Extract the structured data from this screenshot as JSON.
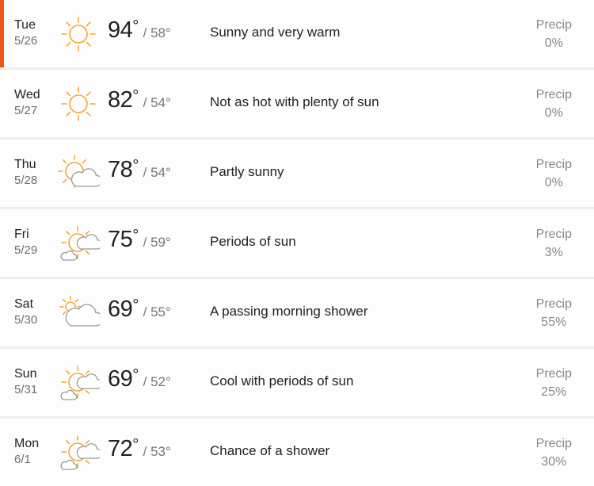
{
  "forecast": [
    {
      "dow": "Tue",
      "date": "5/26",
      "icon": "sunny-icon",
      "hi": "94",
      "lo": "58",
      "phrase": "Sunny and very warm",
      "precip_label": "Precip",
      "precip": "0%",
      "active": true
    },
    {
      "dow": "Wed",
      "date": "5/27",
      "icon": "sunny-icon",
      "hi": "82",
      "lo": "54",
      "phrase": "Not as hot with plenty of sun",
      "precip_label": "Precip",
      "precip": "0%"
    },
    {
      "dow": "Thu",
      "date": "5/28",
      "icon": "partly-sunny-icon",
      "hi": "78",
      "lo": "54",
      "phrase": "Partly sunny",
      "precip_label": "Precip",
      "precip": "0%"
    },
    {
      "dow": "Fri",
      "date": "5/29",
      "icon": "periods-of-sun-icon",
      "hi": "75",
      "lo": "59",
      "phrase": "Periods of sun",
      "precip_label": "Precip",
      "precip": "3%"
    },
    {
      "dow": "Sat",
      "date": "5/30",
      "icon": "mostly-cloudy-icon",
      "hi": "69",
      "lo": "55",
      "phrase": "A passing morning shower",
      "precip_label": "Precip",
      "precip": "55%"
    },
    {
      "dow": "Sun",
      "date": "5/31",
      "icon": "periods-of-sun-icon",
      "hi": "69",
      "lo": "52",
      "phrase": "Cool with periods of sun",
      "precip_label": "Precip",
      "precip": "25%"
    },
    {
      "dow": "Mon",
      "date": "6/1",
      "icon": "periods-of-sun-icon",
      "hi": "72",
      "lo": "53",
      "phrase": "Chance of a shower",
      "precip_label": "Precip",
      "precip": "30%"
    }
  ],
  "degree_symbol": "°",
  "separator": "/",
  "colors": {
    "accent": "#f05514",
    "sun": "#f0a830",
    "cloud": "#9a9a9a"
  }
}
